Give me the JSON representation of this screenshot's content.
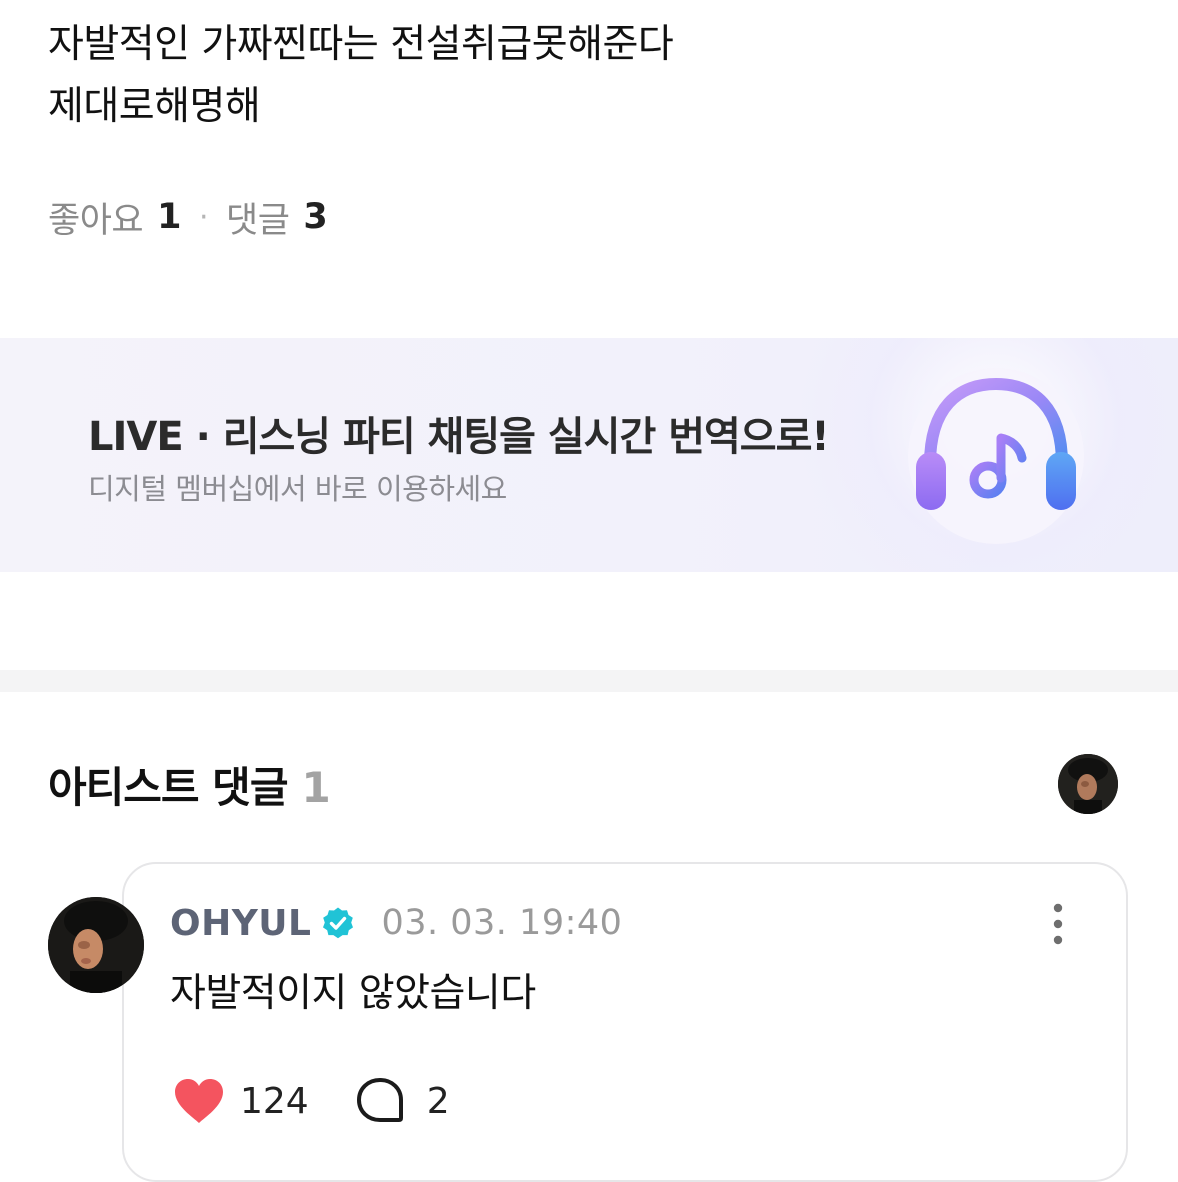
{
  "post": {
    "line1": "자발적인 가짜찐따는 전설취급못해준다",
    "line2": "제대로해명해",
    "likes_label": "좋아요",
    "likes_count": "1",
    "separator": "·",
    "comments_label": "댓글",
    "comments_count": "3"
  },
  "banner": {
    "title": "LIVE · 리스닝 파티 채팅을 실시간 번역으로!",
    "subtitle": "디지털 멤버십에서 바로 이용하세요",
    "icon": "headphones-music-icon"
  },
  "artist_comments": {
    "title": "아티스트 댓글",
    "count": "1"
  },
  "comment": {
    "author": "OHYUL",
    "verified_icon": "verified-badge-icon",
    "timestamp": "03. 03. 19:40",
    "text": "자발적이지 않았습니다",
    "like_count": "124",
    "reply_count": "2",
    "more_icon": "more-vertical-icon"
  },
  "colors": {
    "verified": "#20c3d6",
    "heart": "#f4545f",
    "author": "#5d6476",
    "headphone_gradient_start": "#b289f5",
    "headphone_gradient_end": "#5f7df0"
  }
}
